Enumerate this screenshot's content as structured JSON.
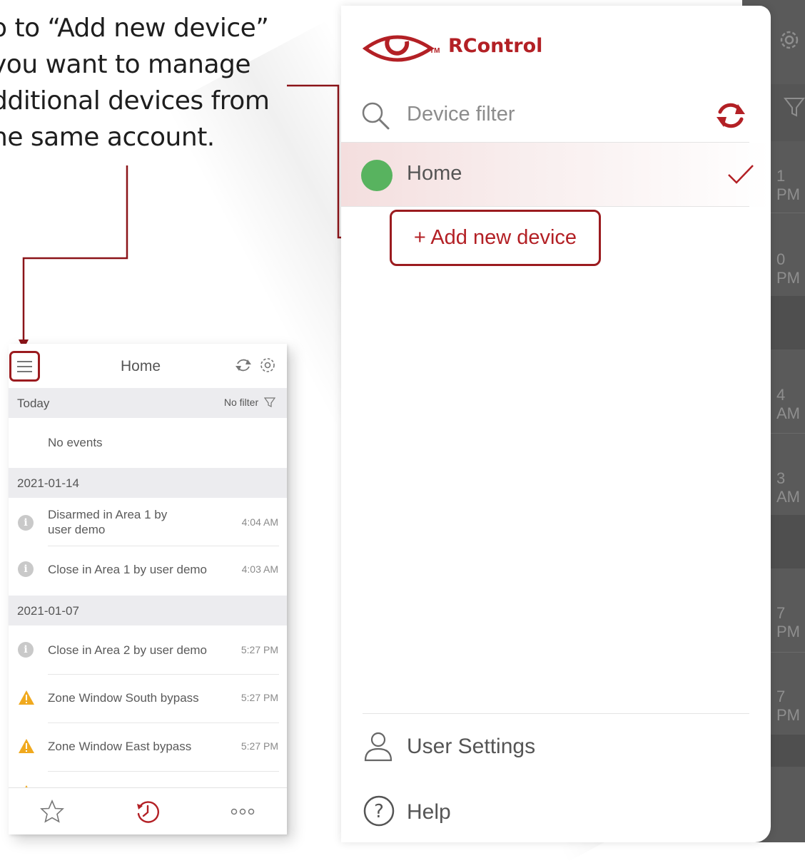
{
  "instruction": {
    "lines": [
      "o to “Add new device”",
      "you want to manage",
      "dditional devices from",
      "he same account."
    ]
  },
  "drawer": {
    "app_name": "RControl",
    "trademark": "TM",
    "search_placeholder": "Device filter",
    "devices": [
      {
        "name": "Home",
        "status": "online",
        "selected": true
      }
    ],
    "add_device_label": "+ Add new device",
    "user_settings_label": "User Settings",
    "help_label": "Help"
  },
  "background_app": {
    "peek_times": [
      "1 PM",
      "0 PM",
      "4 AM",
      "3 AM",
      "7 PM",
      "7 PM"
    ]
  },
  "phone": {
    "title": "Home",
    "today_label": "Today",
    "filter_label": "No filter",
    "no_events": "No events",
    "groups": [
      {
        "date": "2021-01-14",
        "events": [
          {
            "text_line1": "Disarmed in Area 1 by",
            "text_line2": "user demo",
            "time": "4:04 AM",
            "icon": "info-icon"
          },
          {
            "text_line1": "Close in Area 1 by user demo",
            "text_line2": "",
            "time": "4:03 AM",
            "icon": "info-icon"
          }
        ]
      },
      {
        "date": "2021-01-07",
        "events": [
          {
            "text_line1": "Close in Area 2 by user demo",
            "text_line2": "",
            "time": "5:27 PM",
            "icon": "info-icon"
          },
          {
            "text_line1": "Zone Window South bypass",
            "text_line2": "",
            "time": "5:27 PM",
            "icon": "warning-icon"
          },
          {
            "text_line1": "Zone Window East bypass",
            "text_line2": "",
            "time": "5:27 PM",
            "icon": "warning-icon"
          }
        ]
      }
    ],
    "tabs": [
      "favorites-icon",
      "history-icon",
      "more-icon"
    ]
  },
  "colors": {
    "brand_red": "#b32025",
    "highlight_border": "#9b1b1f",
    "online_green": "#58b35f",
    "warning_orange": "#f0a91e"
  }
}
